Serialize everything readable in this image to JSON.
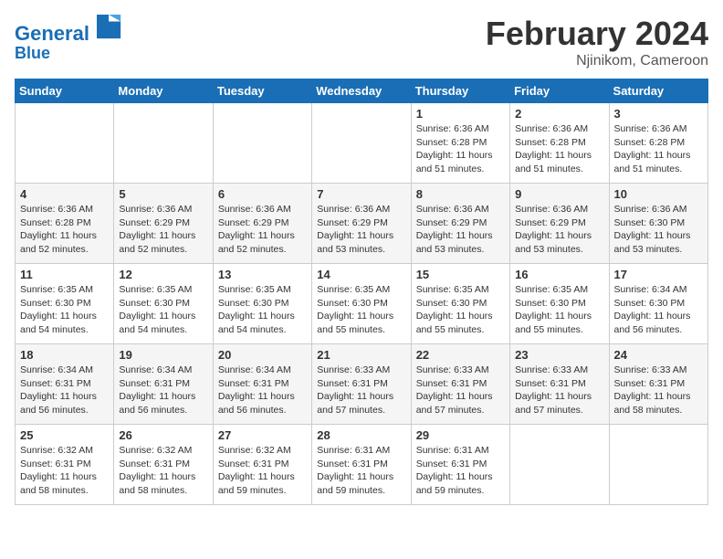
{
  "header": {
    "logo_line1": "General",
    "logo_line2": "Blue",
    "month": "February 2024",
    "location": "Njinikom, Cameroon"
  },
  "days_of_week": [
    "Sunday",
    "Monday",
    "Tuesday",
    "Wednesday",
    "Thursday",
    "Friday",
    "Saturday"
  ],
  "weeks": [
    [
      {
        "day": "",
        "info": ""
      },
      {
        "day": "",
        "info": ""
      },
      {
        "day": "",
        "info": ""
      },
      {
        "day": "",
        "info": ""
      },
      {
        "day": "1",
        "info": "Sunrise: 6:36 AM\nSunset: 6:28 PM\nDaylight: 11 hours\nand 51 minutes."
      },
      {
        "day": "2",
        "info": "Sunrise: 6:36 AM\nSunset: 6:28 PM\nDaylight: 11 hours\nand 51 minutes."
      },
      {
        "day": "3",
        "info": "Sunrise: 6:36 AM\nSunset: 6:28 PM\nDaylight: 11 hours\nand 51 minutes."
      }
    ],
    [
      {
        "day": "4",
        "info": "Sunrise: 6:36 AM\nSunset: 6:28 PM\nDaylight: 11 hours\nand 52 minutes."
      },
      {
        "day": "5",
        "info": "Sunrise: 6:36 AM\nSunset: 6:29 PM\nDaylight: 11 hours\nand 52 minutes."
      },
      {
        "day": "6",
        "info": "Sunrise: 6:36 AM\nSunset: 6:29 PM\nDaylight: 11 hours\nand 52 minutes."
      },
      {
        "day": "7",
        "info": "Sunrise: 6:36 AM\nSunset: 6:29 PM\nDaylight: 11 hours\nand 53 minutes."
      },
      {
        "day": "8",
        "info": "Sunrise: 6:36 AM\nSunset: 6:29 PM\nDaylight: 11 hours\nand 53 minutes."
      },
      {
        "day": "9",
        "info": "Sunrise: 6:36 AM\nSunset: 6:29 PM\nDaylight: 11 hours\nand 53 minutes."
      },
      {
        "day": "10",
        "info": "Sunrise: 6:36 AM\nSunset: 6:30 PM\nDaylight: 11 hours\nand 53 minutes."
      }
    ],
    [
      {
        "day": "11",
        "info": "Sunrise: 6:35 AM\nSunset: 6:30 PM\nDaylight: 11 hours\nand 54 minutes."
      },
      {
        "day": "12",
        "info": "Sunrise: 6:35 AM\nSunset: 6:30 PM\nDaylight: 11 hours\nand 54 minutes."
      },
      {
        "day": "13",
        "info": "Sunrise: 6:35 AM\nSunset: 6:30 PM\nDaylight: 11 hours\nand 54 minutes."
      },
      {
        "day": "14",
        "info": "Sunrise: 6:35 AM\nSunset: 6:30 PM\nDaylight: 11 hours\nand 55 minutes."
      },
      {
        "day": "15",
        "info": "Sunrise: 6:35 AM\nSunset: 6:30 PM\nDaylight: 11 hours\nand 55 minutes."
      },
      {
        "day": "16",
        "info": "Sunrise: 6:35 AM\nSunset: 6:30 PM\nDaylight: 11 hours\nand 55 minutes."
      },
      {
        "day": "17",
        "info": "Sunrise: 6:34 AM\nSunset: 6:30 PM\nDaylight: 11 hours\nand 56 minutes."
      }
    ],
    [
      {
        "day": "18",
        "info": "Sunrise: 6:34 AM\nSunset: 6:31 PM\nDaylight: 11 hours\nand 56 minutes."
      },
      {
        "day": "19",
        "info": "Sunrise: 6:34 AM\nSunset: 6:31 PM\nDaylight: 11 hours\nand 56 minutes."
      },
      {
        "day": "20",
        "info": "Sunrise: 6:34 AM\nSunset: 6:31 PM\nDaylight: 11 hours\nand 56 minutes."
      },
      {
        "day": "21",
        "info": "Sunrise: 6:33 AM\nSunset: 6:31 PM\nDaylight: 11 hours\nand 57 minutes."
      },
      {
        "day": "22",
        "info": "Sunrise: 6:33 AM\nSunset: 6:31 PM\nDaylight: 11 hours\nand 57 minutes."
      },
      {
        "day": "23",
        "info": "Sunrise: 6:33 AM\nSunset: 6:31 PM\nDaylight: 11 hours\nand 57 minutes."
      },
      {
        "day": "24",
        "info": "Sunrise: 6:33 AM\nSunset: 6:31 PM\nDaylight: 11 hours\nand 58 minutes."
      }
    ],
    [
      {
        "day": "25",
        "info": "Sunrise: 6:32 AM\nSunset: 6:31 PM\nDaylight: 11 hours\nand 58 minutes."
      },
      {
        "day": "26",
        "info": "Sunrise: 6:32 AM\nSunset: 6:31 PM\nDaylight: 11 hours\nand 58 minutes."
      },
      {
        "day": "27",
        "info": "Sunrise: 6:32 AM\nSunset: 6:31 PM\nDaylight: 11 hours\nand 59 minutes."
      },
      {
        "day": "28",
        "info": "Sunrise: 6:31 AM\nSunset: 6:31 PM\nDaylight: 11 hours\nand 59 minutes."
      },
      {
        "day": "29",
        "info": "Sunrise: 6:31 AM\nSunset: 6:31 PM\nDaylight: 11 hours\nand 59 minutes."
      },
      {
        "day": "",
        "info": ""
      },
      {
        "day": "",
        "info": ""
      }
    ]
  ]
}
